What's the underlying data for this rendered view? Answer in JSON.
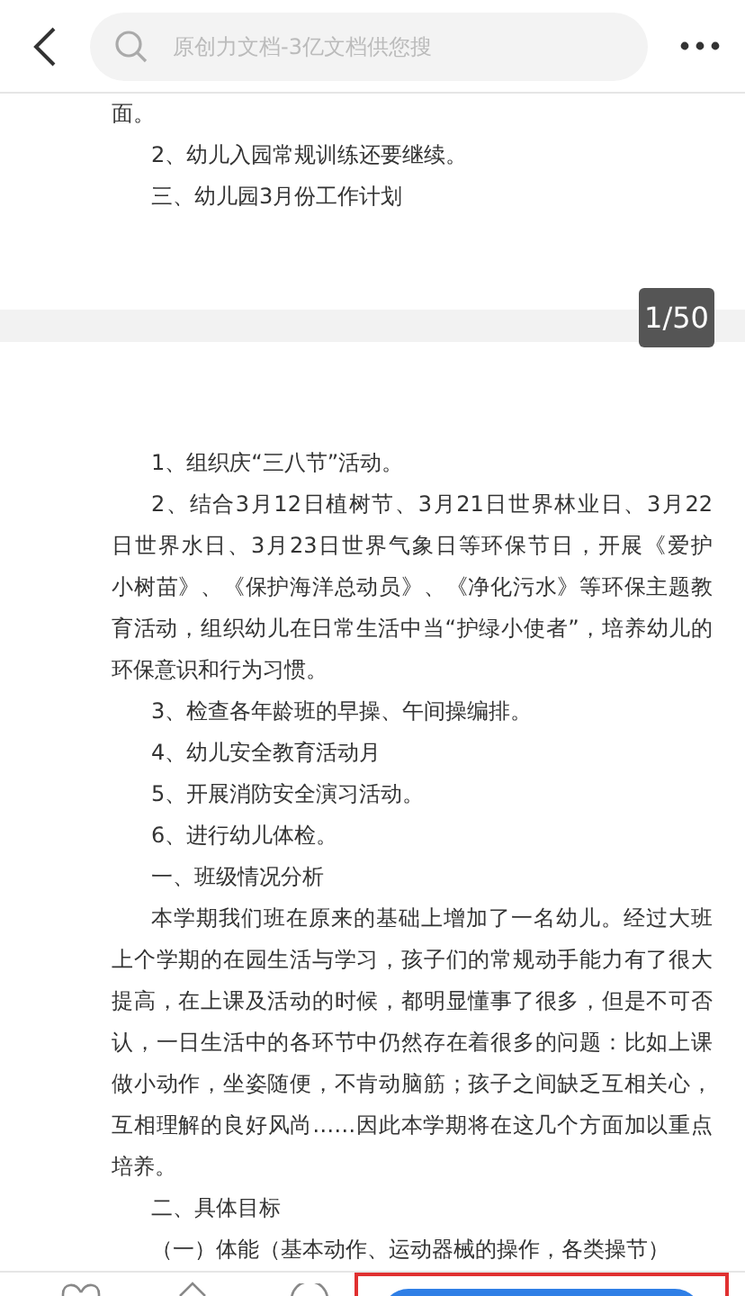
{
  "top_bar": {
    "search": {
      "placeholder": "原创力文档-3亿文档供您搜"
    }
  },
  "page_badge": "1/50",
  "pages": [
    {
      "paragraphs": [
        {
          "indent": false,
          "lines": [
            "面。"
          ]
        },
        {
          "indent": true,
          "lines": [
            "2、幼儿入园常规训练还要继续。"
          ]
        },
        {
          "indent": true,
          "lines": [
            "三、幼儿园3月份工作计划"
          ]
        }
      ]
    },
    {
      "paragraphs": [
        {
          "indent": true,
          "lines": [
            "1、组织庆“三八节”活动。"
          ]
        },
        {
          "indent": true,
          "lines": [
            "2、结合3月12日植树节、3月21日世界林业日、3月22",
            "日世界水日、3月23日世界气象日等环保节日，开展《爱护",
            "小树苗》、《保护海洋总动员》、《净化污水》等环保主题教",
            "育活动，组织幼儿在日常生活中当“护绿小使者”，培养幼儿的",
            "环保意识和行为习惯。"
          ]
        },
        {
          "indent": true,
          "lines": [
            "3、检查各年龄班的早操、午间操编排。"
          ]
        },
        {
          "indent": true,
          "lines": [
            "4、幼儿安全教育活动月"
          ]
        },
        {
          "indent": true,
          "lines": [
            "5、开展消防安全演习活动。"
          ]
        },
        {
          "indent": true,
          "lines": [
            "6、进行幼儿体检。"
          ]
        },
        {
          "indent": true,
          "lines": [
            "一、班级情况分析"
          ]
        },
        {
          "indent": true,
          "lines": [
            "本学期我们班在原来的基础上增加了一名幼儿。经过大班",
            "上个学期的在园生活与学习，孩子们的常规动手能力有了很大",
            "提高，在上课及活动的时候，都明显懂事了很多，但是不可否",
            "认，一日生活中的各环节中仍然存在着很多的问题：比如上课",
            "做小动作，坐姿随便，不肯动脑筋；孩子之间缺乏互相关心，",
            "互相理解的良好风尚……因此本学期将在这几个方面加以重点",
            "培养。"
          ]
        },
        {
          "indent": true,
          "lines": [
            "二、具体目标"
          ]
        },
        {
          "indent": true,
          "lines": [
            "（一）体能（基本动作、运动器械的操作，各类操节）"
          ]
        }
      ]
    }
  ]
}
